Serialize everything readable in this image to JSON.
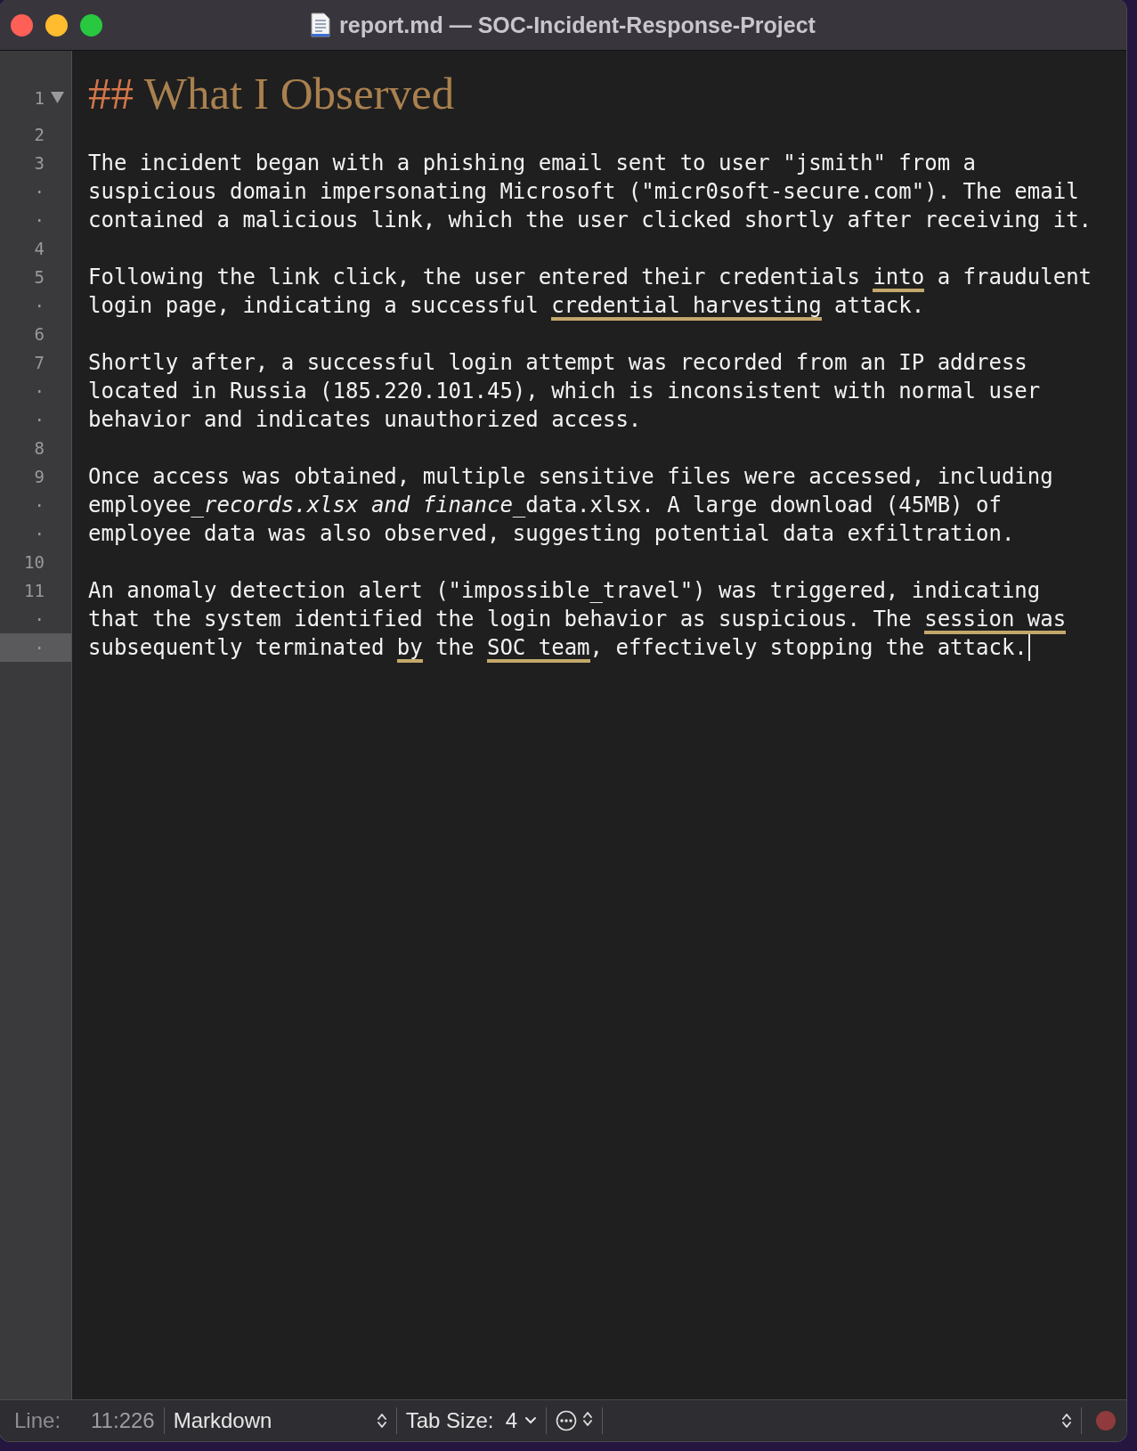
{
  "window": {
    "title": "report.md — SOC-Incident-Response-Project"
  },
  "editor": {
    "lines": [
      {
        "foldable": true,
        "rows": [
          {
            "gutter": "1",
            "current": false,
            "kind": "heading",
            "marker": "##",
            "text": "What I Observed"
          }
        ]
      },
      {
        "foldable": false,
        "rows": [
          {
            "gutter": "2",
            "current": false,
            "kind": "text",
            "segments": []
          }
        ]
      },
      {
        "foldable": false,
        "rows": [
          {
            "gutter": "3",
            "current": false,
            "kind": "text",
            "segments": [
              {
                "text": "The incident began with a phishing email sent to user \"jsmith\" from a",
                "underlined": false
              }
            ]
          },
          {
            "gutter": "·",
            "current": false,
            "kind": "text",
            "segments": [
              {
                "text": "suspicious domain impersonating Microsoft (\"micr0soft-secure.com\"). The email",
                "underlined": false
              }
            ]
          },
          {
            "gutter": "·",
            "current": false,
            "kind": "text",
            "segments": [
              {
                "text": "contained a malicious link, which the user clicked shortly after receiving it.",
                "underlined": false
              }
            ]
          }
        ]
      },
      {
        "foldable": false,
        "rows": [
          {
            "gutter": "4",
            "current": false,
            "kind": "text",
            "segments": []
          }
        ]
      },
      {
        "foldable": false,
        "rows": [
          {
            "gutter": "5",
            "current": false,
            "kind": "text",
            "segments": [
              {
                "text": "Following the link click, the user entered their credentials ",
                "underlined": false
              },
              {
                "text": "into",
                "underlined": true
              },
              {
                "text": " a fraudulent",
                "underlined": false
              }
            ]
          },
          {
            "gutter": "·",
            "current": false,
            "kind": "text",
            "segments": [
              {
                "text": "login page, indicating a successful ",
                "underlined": false
              },
              {
                "text": "credential harvesting",
                "underlined": true
              },
              {
                "text": " attack.",
                "underlined": false
              }
            ]
          }
        ]
      },
      {
        "foldable": false,
        "rows": [
          {
            "gutter": "6",
            "current": false,
            "kind": "text",
            "segments": []
          }
        ]
      },
      {
        "foldable": false,
        "rows": [
          {
            "gutter": "7",
            "current": false,
            "kind": "text",
            "segments": [
              {
                "text": "Shortly after, a successful login attempt was recorded from an IP address",
                "underlined": false
              }
            ]
          },
          {
            "gutter": "·",
            "current": false,
            "kind": "text",
            "segments": [
              {
                "text": "located in Russia (185.220.101.45), which is inconsistent with normal user",
                "underlined": false
              }
            ]
          },
          {
            "gutter": "·",
            "current": false,
            "kind": "text",
            "segments": [
              {
                "text": "behavior and indicates unauthorized access.",
                "underlined": false
              }
            ]
          }
        ]
      },
      {
        "foldable": false,
        "rows": [
          {
            "gutter": "8",
            "current": false,
            "kind": "text",
            "segments": []
          }
        ]
      },
      {
        "foldable": false,
        "rows": [
          {
            "gutter": "9",
            "current": false,
            "kind": "text",
            "segments": [
              {
                "text": "Once access was obtained, multiple sensitive files were accessed, including",
                "underlined": false
              }
            ]
          },
          {
            "gutter": "·",
            "current": false,
            "kind": "text",
            "segments": [
              {
                "text": "employee_",
                "underlined": false,
                "italic": false
              },
              {
                "text": "records.xlsx and finance",
                "underlined": false,
                "italic": true
              },
              {
                "text": "_data.xlsx. A large download (45MB) of",
                "underlined": false,
                "italic": false
              }
            ]
          },
          {
            "gutter": "·",
            "current": false,
            "kind": "text",
            "segments": [
              {
                "text": "employee data was also observed, suggesting potential data exfiltration.",
                "underlined": false
              }
            ]
          }
        ]
      },
      {
        "foldable": false,
        "rows": [
          {
            "gutter": "10",
            "current": false,
            "kind": "text",
            "segments": []
          }
        ]
      },
      {
        "foldable": false,
        "rows": [
          {
            "gutter": "11",
            "current": false,
            "kind": "text",
            "segments": [
              {
                "text": "An anomaly detection alert (\"impossible_travel\") was triggered, indicating",
                "underlined": false
              }
            ]
          },
          {
            "gutter": "·",
            "current": false,
            "kind": "text",
            "segments": [
              {
                "text": "that the system identified the login behavior as suspicious. The ",
                "underlined": false
              },
              {
                "text": "session was",
                "underlined": true
              }
            ]
          },
          {
            "gutter": "·",
            "current": true,
            "kind": "text",
            "segments": [
              {
                "text": "subsequently terminated ",
                "underlined": false
              },
              {
                "text": "by",
                "underlined": true
              },
              {
                "text": " the ",
                "underlined": false
              },
              {
                "text": "SOC team",
                "underlined": true
              },
              {
                "text": ", effectively stopping the attack.",
                "underlined": false
              }
            ]
          }
        ]
      }
    ]
  },
  "status_bar": {
    "line_label": "Line:",
    "line_value": "11:226",
    "language": "Markdown",
    "tab_size_label": "Tab Size:",
    "tab_size": "4"
  }
}
